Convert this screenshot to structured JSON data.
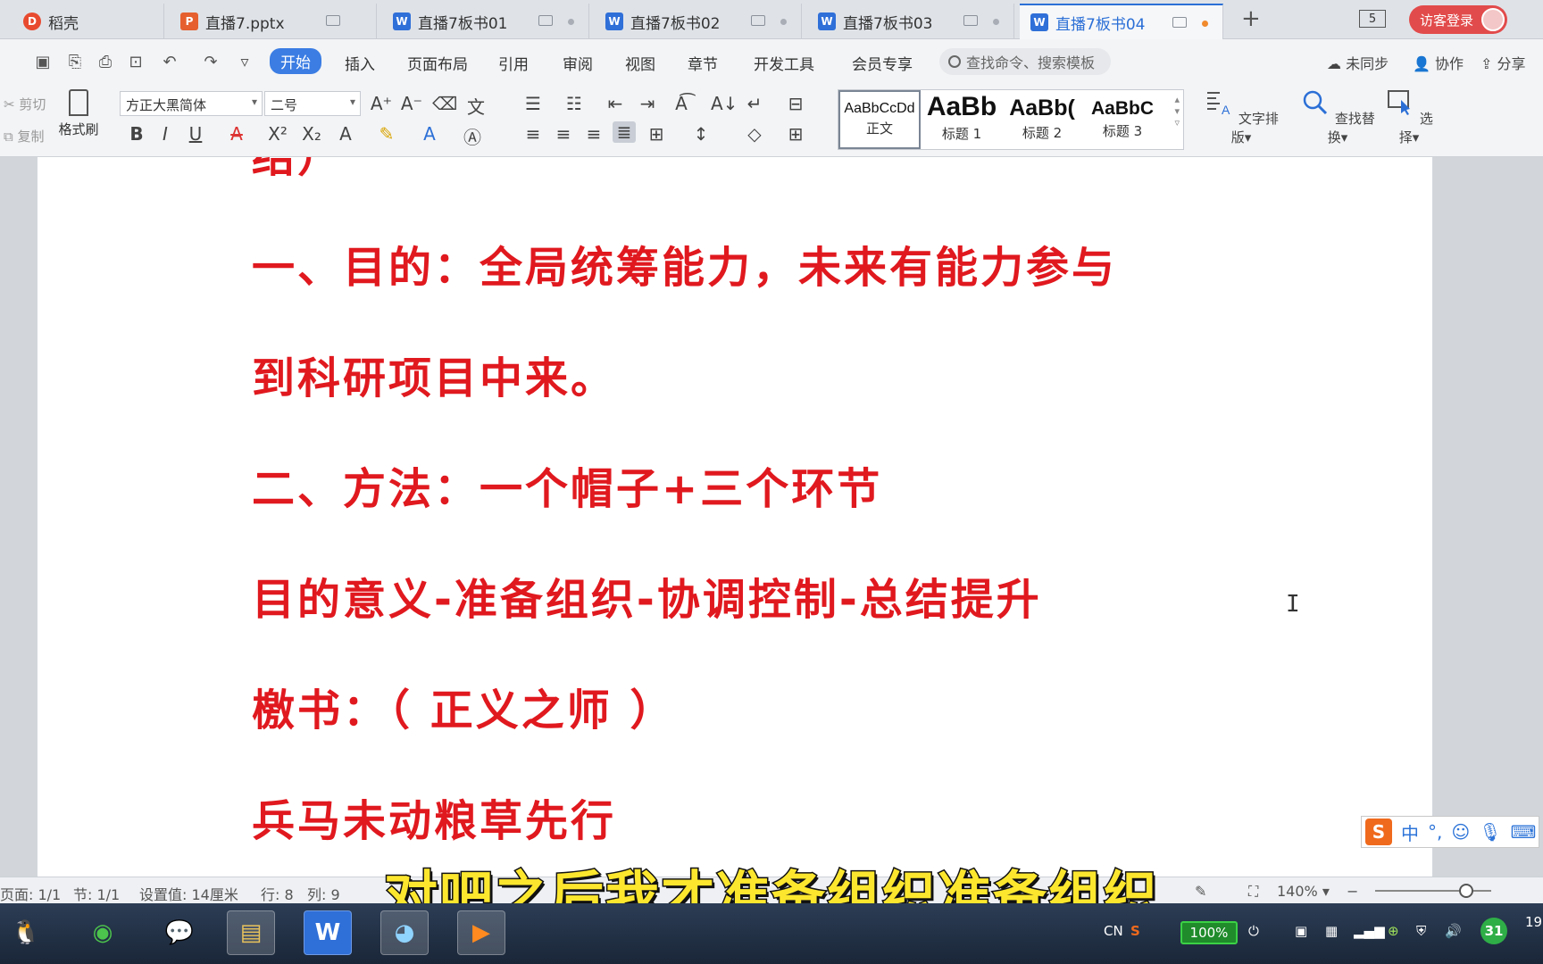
{
  "tabs": [
    {
      "label": "稻壳",
      "icon": "daoke-icon",
      "active": false
    },
    {
      "label": "直播7.pptx",
      "icon": "pptx-file-icon",
      "active": false
    },
    {
      "label": "直播7板书01",
      "icon": "word-file-icon",
      "active": false
    },
    {
      "label": "直播7板书02",
      "icon": "word-file-icon",
      "active": false
    },
    {
      "label": "直播7板书03",
      "icon": "word-file-icon",
      "active": false
    },
    {
      "label": "直播7板书04",
      "icon": "word-file-icon",
      "active": true
    }
  ],
  "tab_counter": "5",
  "login_label": "访客登录",
  "menu": {
    "items": [
      "开始",
      "插入",
      "页面布局",
      "引用",
      "审阅",
      "视图",
      "章节",
      "开发工具",
      "会员专享"
    ],
    "active": "开始",
    "search_placeholder": "查找命令、搜索模板",
    "right": [
      "未同步",
      "协作",
      "分享"
    ]
  },
  "ribbon": {
    "cut": "剪切",
    "copy": "复制",
    "format_painter": "格式刷",
    "font_name": "方正大黑简体",
    "font_size": "二号",
    "styles": [
      {
        "sample": "AaBbCcDd",
        "name": "正文"
      },
      {
        "sample": "AaBb",
        "name": "标题 1"
      },
      {
        "sample": "AaBb(",
        "name": "标题 2"
      },
      {
        "sample": "AaBbC",
        "name": "标题 3"
      }
    ],
    "text_layout": "文字排版",
    "find_replace": "查找替换",
    "select": "选择"
  },
  "document": {
    "lines": [
      "结）",
      "一、目的：全局统筹能力，未来有能力参与",
      "到科研项目中来。",
      "二、方法：一个帽子+三个环节",
      "目的意义-准备组织-协调控制-总结提升",
      "檄书：（ 正义之师 ）",
      "兵马未动粮草先行"
    ],
    "text_color": "#e0191f"
  },
  "ime": {
    "mode": "中"
  },
  "status": {
    "page": "页面: 1/1",
    "section": "节: 1/1",
    "setting": "设置值: 14厘米",
    "row": "行: 8",
    "col": "列: 9",
    "zoom": "140%"
  },
  "subtitle": "对吧之后我才准备组织准备组织",
  "taskbar": {
    "lang": "CN",
    "battery": "100%",
    "calendar_day": "31",
    "clock_partial": "19"
  }
}
